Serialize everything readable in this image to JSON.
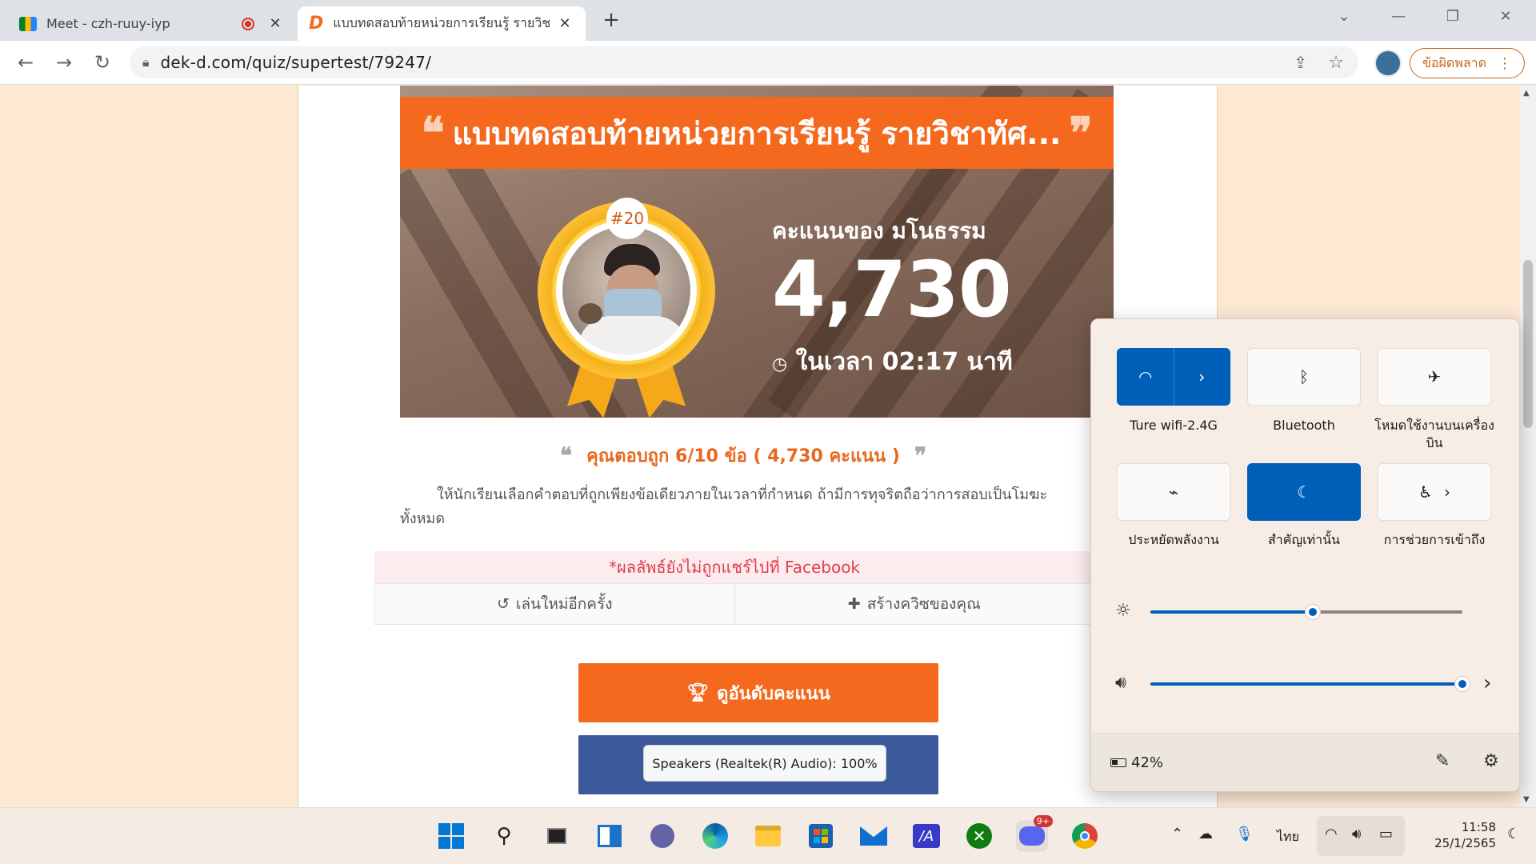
{
  "browser": {
    "tabs": [
      {
        "title": "Meet - czh-ruuy-iyp",
        "icon": "meet-icon",
        "recording": true
      },
      {
        "title": "แบบทดสอบท้ายหน่วยการเรียนรู้ รายวิช",
        "icon": "dekd-icon",
        "active": true
      }
    ],
    "url": "dek-d.com/quiz/supertest/79247/",
    "error_button": "ข้อผิดพลาด"
  },
  "quiz": {
    "title": "แบบทดสอบท้ายหน่วยการเรียนรู้ รายวิชาทัศ...",
    "rank": "#20",
    "score_label": "คะแนนของ มโนธรรม",
    "score": "4,730",
    "time_text": "ในเวลา 02:17 นาที",
    "answer_summary": "คุณตอบถูก 6/10 ข้อ ( 4,730 คะแนน )",
    "description": "ให้นักเรียนเลือกคำตอบที่ถูกเพียงข้อเดียวภายในเวลาที่กำหนด ถ้ามีการทุจริตถือว่าการสอบเป็นโมฆะทั้งหมด",
    "share_warning": "*ผลลัพธ์ยังไม่ถูกแชร์ไปที่ Facebook",
    "replay": "เล่นใหม่อีกครั้ง",
    "create_quiz": "สร้างควิซของคุณ",
    "ranking_button": "ดูอันดับคะแนน",
    "brand_orange": "#f5691f",
    "facebook_blue": "#3b5998"
  },
  "tooltip": "Speakers (Realtek(R) Audio): 100%",
  "quick_settings": {
    "tiles": [
      {
        "label": "Ture wifi-2.4G",
        "icon": "wifi-icon",
        "on": true
      },
      {
        "label": "Bluetooth",
        "icon": "bluetooth-icon",
        "on": false
      },
      {
        "label": "โหมดใช้งานบนเครื่องบิน",
        "icon": "airplane-icon",
        "on": false
      },
      {
        "label": "ประหยัดพลังงาน",
        "icon": "battery-saver-icon",
        "on": false
      },
      {
        "label": "สำคัญเท่านั้น",
        "icon": "focus-moon-icon",
        "on": true
      },
      {
        "label": "การช่วยการเข้าถึง",
        "icon": "accessibility-icon",
        "on": false
      }
    ],
    "brightness_pct": 52,
    "volume_pct": 100,
    "battery": "42%",
    "accent": "#005fb8"
  },
  "taskbar": {
    "apps": [
      "windows-start-icon",
      "search-icon",
      "task-view-icon",
      "widgets-icon",
      "teams-chat-icon",
      "edge-icon",
      "file-explorer-icon",
      "store-icon",
      "mail-icon",
      "vs-code-icon",
      "xbox-icon",
      "discord-icon",
      "chrome-icon"
    ],
    "discord_badge": "9+",
    "language": "ไทย",
    "time": "11:58",
    "date": "25/1/2565"
  }
}
